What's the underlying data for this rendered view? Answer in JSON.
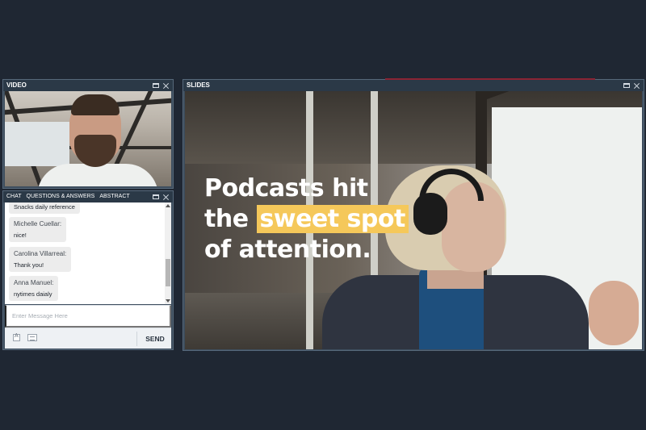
{
  "video_panel": {
    "title": "VIDEO"
  },
  "slides_panel": {
    "title": "SLIDES"
  },
  "chat_panel": {
    "tabs": [
      "CHAT",
      "QUESTIONS & ANSWERS",
      "ABSTRACT"
    ],
    "messages": [
      {
        "name": "",
        "text": "Snacks daily reference"
      },
      {
        "name": "Michelle Cuellar:",
        "text": "nice!"
      },
      {
        "name": "Carolina Villarreal:",
        "text": "Thank you!"
      },
      {
        "name": "Anna Manuel:",
        "text": "nytimes daialy"
      }
    ],
    "input_placeholder": "Enter Message Here",
    "send_label": "SEND"
  },
  "slide": {
    "line1": "Podcasts hit",
    "line2_prefix": "the",
    "line2_highlight": "sweet spot",
    "line3": "of attention.",
    "highlight_color": "#f5c85a"
  },
  "colors": {
    "page_bg": "#1f2733",
    "panel_header": "#2b3947",
    "panel_body": "#3e4e5e"
  }
}
